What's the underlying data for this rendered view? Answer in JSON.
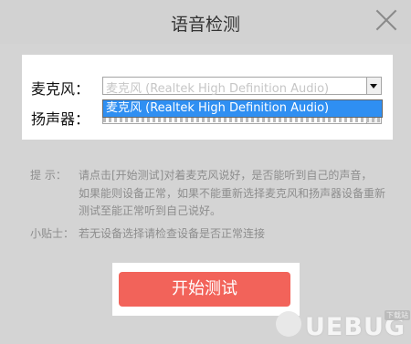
{
  "window": {
    "title": "语音检测"
  },
  "devices": {
    "mic_label": "麦克风：",
    "speaker_label": "扬声器：",
    "mic_value": "麦克风 (Realtek High Definition Audio)",
    "dropdown_option": "麦克风 (Realtek High Definition Audio)"
  },
  "tips": {
    "label": "提 示：",
    "line1": "请点击[开始测试]对着麦克风说好，是否能听到自己的声音，",
    "line2": "如果能则设备正常，如果不能重新选择麦克风和扬声器设备重新",
    "line3": "测试至能正常听到自己说好。"
  },
  "note": {
    "label": "小贴士：",
    "text": "若无设备选择请检查设备是否正常连接"
  },
  "actions": {
    "start_label": "开始测试"
  },
  "watermark": {
    "logo_text": "UEBUG",
    "sub_text": "下载站"
  }
}
